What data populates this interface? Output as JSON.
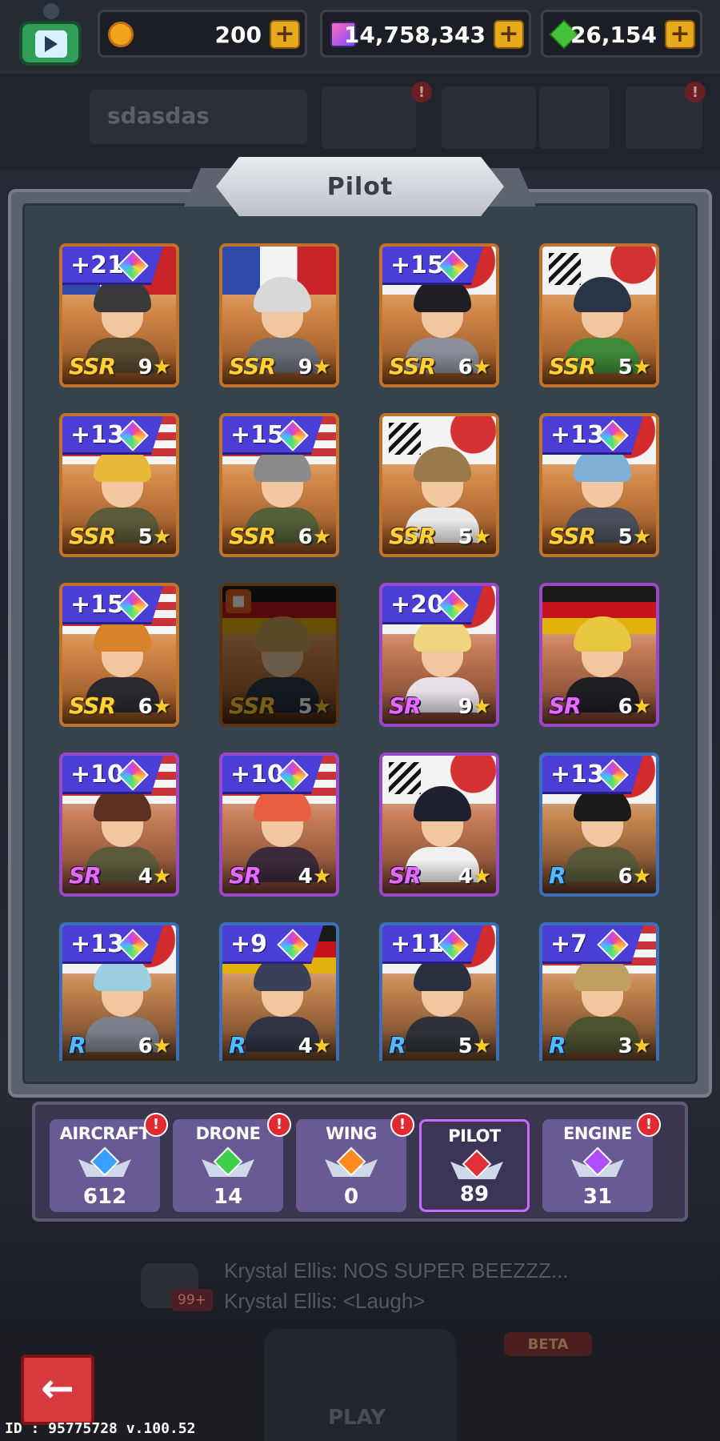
{
  "top_bar": {
    "coins": "200",
    "tickets": "14,758,343",
    "gems": "26,154",
    "plus_symbol": "+"
  },
  "background": {
    "player_name": "sdasdas",
    "alert_symbol": "!",
    "chat_line_1": "Krystal Ellis: NOS SUPER BEEZZZ...",
    "chat_line_2": "Krystal Ellis: <Laugh>",
    "chat_badge": "99+",
    "play_label": "PLAY",
    "beta_label": "BETA"
  },
  "panel": {
    "title": "Pilot"
  },
  "pilots": [
    {
      "level": "+21",
      "rarity": "SSR",
      "stars": "9",
      "flag": "ussr",
      "hair": "#3a3a3a",
      "outfit": "#5a4a30"
    },
    {
      "level": "",
      "rarity": "SSR",
      "stars": "9",
      "flag": "ussr",
      "hair": "#d8d8d8",
      "outfit": "#6b6f78"
    },
    {
      "level": "+15",
      "rarity": "SSR",
      "stars": "6",
      "flag": "jp",
      "hair": "#1e1e24",
      "outfit": "#8a8f9a"
    },
    {
      "level": "",
      "rarity": "SSR",
      "stars": "5",
      "flag": "kr",
      "hair": "#2b3446",
      "outfit": "#3f8a3a",
      "striped": true
    },
    {
      "level": "+13",
      "rarity": "SSR",
      "stars": "5",
      "flag": "us",
      "hair": "#e8b838",
      "outfit": "#5b5a3a"
    },
    {
      "level": "+15",
      "rarity": "SSR",
      "stars": "6",
      "flag": "us",
      "hair": "#8a8a8a",
      "outfit": "#54603a"
    },
    {
      "level": "",
      "rarity": "SSR",
      "stars": "5",
      "flag": "kr",
      "hair": "#9a7a4a",
      "outfit": "#eaeaea",
      "striped": true
    },
    {
      "level": "+13",
      "rarity": "SSR",
      "stars": "5",
      "flag": "jp",
      "hair": "#7fb0d8",
      "outfit": "#4a4f5a"
    },
    {
      "level": "+15",
      "rarity": "SSR",
      "stars": "6",
      "flag": "us",
      "hair": "#d8822a",
      "outfit": "#2a2a30"
    },
    {
      "level": "",
      "rarity": "SSR",
      "stars": "5",
      "flag": "de",
      "hair": "#c8a050",
      "outfit": "#2f3a4a",
      "locked": true
    },
    {
      "level": "+20",
      "rarity": "SR",
      "stars": "9",
      "flag": "jp",
      "hair": "#f0d580",
      "outfit": "#e8e0e8"
    },
    {
      "level": "",
      "rarity": "SR",
      "stars": "6",
      "flag": "de",
      "hair": "#e8c640",
      "outfit": "#1e1e24"
    },
    {
      "level": "+10",
      "rarity": "SR",
      "stars": "4",
      "flag": "us",
      "hair": "#5a3020",
      "outfit": "#5b5a3a"
    },
    {
      "level": "+10",
      "rarity": "SR",
      "stars": "4",
      "flag": "us",
      "hair": "#e86040",
      "outfit": "#3a2a3a"
    },
    {
      "level": "",
      "rarity": "SR",
      "stars": "4",
      "flag": "kr",
      "hair": "#1e2030",
      "outfit": "#f0f0f0",
      "striped": true
    },
    {
      "level": "+13",
      "rarity": "R",
      "stars": "6",
      "flag": "jp",
      "hair": "#1a1a1a",
      "outfit": "#5a5a3a"
    },
    {
      "level": "+13",
      "rarity": "R",
      "stars": "6",
      "flag": "jp",
      "hair": "#9ad0e0",
      "outfit": "#7a7f8a"
    },
    {
      "level": "+9",
      "rarity": "R",
      "stars": "4",
      "flag": "de",
      "hair": "#3a4058",
      "outfit": "#2f3444"
    },
    {
      "level": "+11",
      "rarity": "R",
      "stars": "5",
      "flag": "jp",
      "hair": "#2a3040",
      "outfit": "#2e3238"
    },
    {
      "level": "+7",
      "rarity": "R",
      "stars": "3",
      "flag": "us",
      "hair": "#c0a060",
      "outfit": "#4a5230"
    }
  ],
  "tabs": [
    {
      "label": "AIRCRAFT",
      "count": "612",
      "alert": true,
      "color": "#3aa0ff",
      "active": false
    },
    {
      "label": "DRONE",
      "count": "14",
      "alert": true,
      "color": "#3fcf4a",
      "active": false
    },
    {
      "label": "WING",
      "count": "0",
      "alert": true,
      "color": "#ff8a1e",
      "active": false
    },
    {
      "label": "PILOT",
      "count": "89",
      "alert": false,
      "color": "#e0303a",
      "active": true
    },
    {
      "label": "ENGINE",
      "count": "31",
      "alert": true,
      "color": "#b04dff",
      "active": false
    }
  ],
  "footer": {
    "back_symbol": "←",
    "id_text": "ID : 95775728 v.100.52"
  },
  "colors": {
    "ssr_border": "#c0732a",
    "sr_border": "#9a47c8",
    "r_border": "#3d6fb8",
    "level_badge": "#4b3ed6",
    "active_tab_border": "#c56bff"
  }
}
